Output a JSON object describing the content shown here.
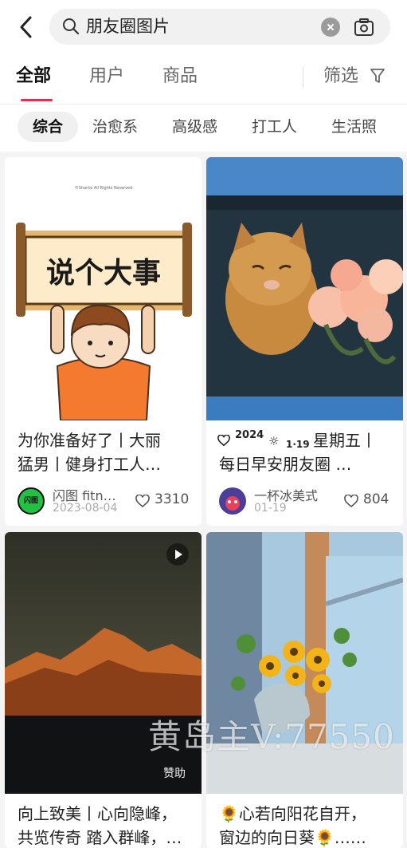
{
  "search": {
    "query": "朋友圈图片"
  },
  "tabs": [
    {
      "label": "全部",
      "active": true
    },
    {
      "label": "用户",
      "active": false
    },
    {
      "label": "商品",
      "active": false
    }
  ],
  "filter": {
    "label": "筛选"
  },
  "chips": [
    "综合",
    "治愈系",
    "高级感",
    "打工人",
    "生活照"
  ],
  "cards": [
    {
      "image_text": "说个大事",
      "image_small": "©Shanto All Rights Reserved",
      "title": "为你准备好了丨大丽\n猛男丨健身打工人…",
      "author": "闪图 fitn…",
      "date": "2023-08-04",
      "likes": "3310",
      "avatar_text": "闪图"
    },
    {
      "title_prefix_year": "2024",
      "title_prefix_date": "1·19",
      "title": "星期五丨\n每日早安朋友圈 …",
      "author": "一杯冰美式",
      "date": "01-19",
      "likes": "804"
    },
    {
      "badge": "赞助",
      "title": "向上致美丨心向隐峰，\n共览传奇 踏入群峰，…"
    },
    {
      "title": "🌻心若向阳花自开，\n窗边的向日葵🌻……"
    }
  ],
  "watermark": "黄岛主V:77550"
}
